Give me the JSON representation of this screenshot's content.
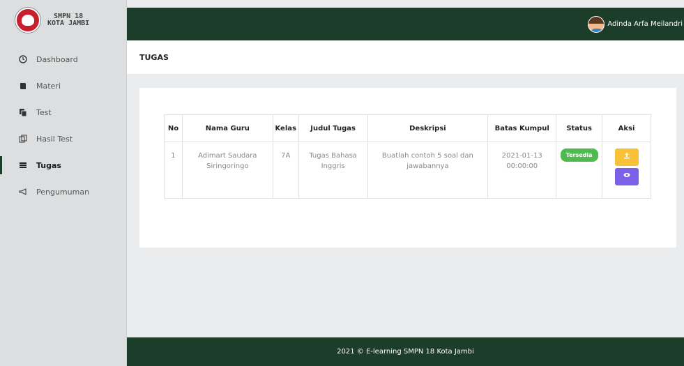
{
  "brand": {
    "line1": "SMPN 18",
    "line2": "KOTA JAMBI",
    "logo_text": "SMP NEGERI 18 KOTA JAMBI"
  },
  "sidebar": {
    "items": [
      {
        "label": "Dashboard",
        "icon": "clock-icon"
      },
      {
        "label": "Materi",
        "icon": "book-icon"
      },
      {
        "label": "Test",
        "icon": "copy-icon"
      },
      {
        "label": "Hasil Test",
        "icon": "clipboard-icon"
      },
      {
        "label": "Tugas",
        "icon": "list-icon",
        "active": true
      },
      {
        "label": "Pengumuman",
        "icon": "megaphone-icon"
      }
    ]
  },
  "topbar": {
    "user_name": "Adinda Arfa Meilandri"
  },
  "page": {
    "title": "TUGAS"
  },
  "table": {
    "headers": [
      "No",
      "Nama Guru",
      "Kelas",
      "Judul Tugas",
      "Deskripsi",
      "Batas Kumpul",
      "Status",
      "Aksi"
    ],
    "rows": [
      {
        "no": "1",
        "nama_guru": "Adimart Saudara Siringoringo",
        "kelas": "7A",
        "judul": "Tugas Bahasa Inggris",
        "deskripsi": "Buatlah contoh 5 soal dan jawabannya",
        "batas": "2021-01-13 00:00:00",
        "status": "Tersedia"
      }
    ]
  },
  "footer": {
    "text": "2021 © E-learning SMPN 18 Kota Jambi"
  },
  "colors": {
    "primary": "#1b3d2a",
    "upload": "#f7c138",
    "view": "#7b61e8",
    "status": "#4fbb4f"
  }
}
